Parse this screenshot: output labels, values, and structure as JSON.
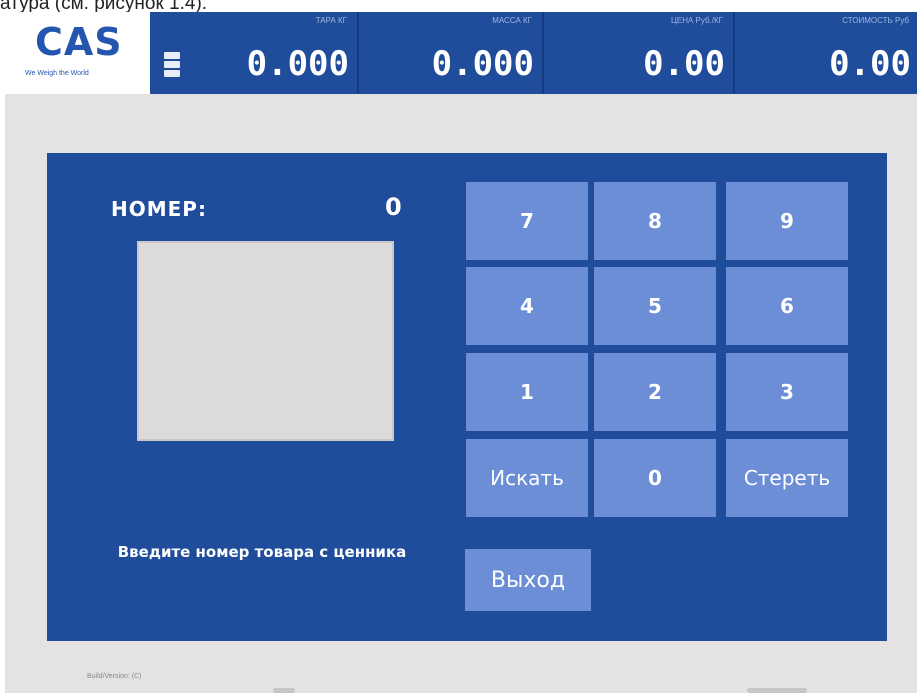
{
  "caption": "атура (см. рисунок 1.4).",
  "brand": {
    "logo": "CAS",
    "tagline": "We Weigh the World"
  },
  "display": {
    "tare": {
      "label": "ТАРА  КГ",
      "value": "0.000"
    },
    "mass": {
      "label": "МАССА  КГ",
      "value": "0.000"
    },
    "price": {
      "label": "ЦЕНА  Руб./КГ",
      "value": "0.00"
    },
    "cost": {
      "label": "СТОИМОСТЬ  Руб",
      "value": "0.00"
    }
  },
  "search_panel": {
    "number_label": "НОМЕР:",
    "number_value": "0",
    "hint": "Введите номер товара с ценника"
  },
  "keypad": {
    "rows": [
      [
        "7",
        "8",
        "9"
      ],
      [
        "4",
        "5",
        "6"
      ],
      [
        "1",
        "2",
        "3"
      ],
      [
        "Искать",
        "0",
        "Стереть"
      ]
    ],
    "exit": "Выход"
  },
  "footer": {
    "text": "Build/Version: (C)"
  },
  "colors": {
    "panel": "#1f4d9c",
    "key": "#6b8ed6",
    "background": "#e4e2e3"
  },
  "icons": {
    "mode": "mode-indicator-icon",
    "logo": "cas-logo-icon"
  }
}
